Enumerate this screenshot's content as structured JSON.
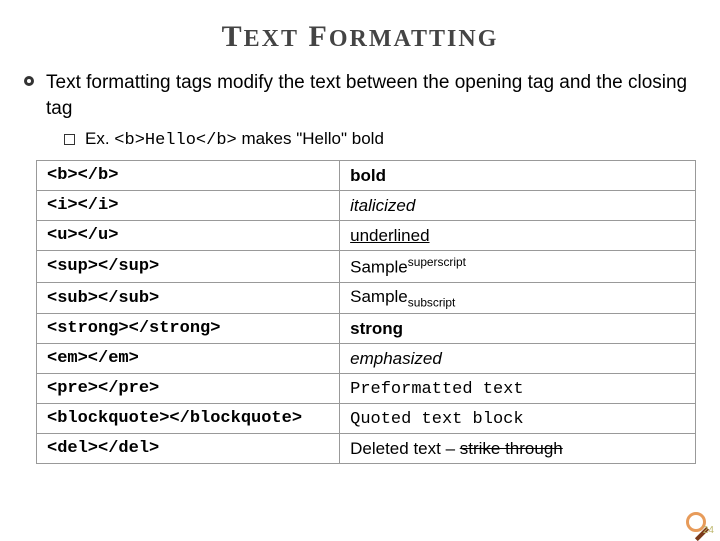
{
  "title_parts": {
    "t1": "T",
    "t2": "EXT",
    "sp": " ",
    "f1": "F",
    "f2": "ORMATTING"
  },
  "desc": "Text formatting tags modify the text between the opening tag and the closing tag",
  "example": {
    "prefix": "Ex. ",
    "code": "<b>Hello</b>",
    "suffix": " makes \"Hello\" bold"
  },
  "rows": [
    {
      "tag": "<b></b>",
      "type": "bold",
      "text": "bold"
    },
    {
      "tag": "<i></i>",
      "type": "ital",
      "text": "italicized"
    },
    {
      "tag": "<u></u>",
      "type": "und",
      "text": "underlined"
    },
    {
      "tag": "<sup></sup>",
      "type": "sup",
      "base": "Sample",
      "script": "superscript"
    },
    {
      "tag": "<sub></sub>",
      "type": "sub",
      "base": "Sample",
      "script": "subscript"
    },
    {
      "tag": "<strong></strong>",
      "type": "bold",
      "text": "strong"
    },
    {
      "tag": "<em></em>",
      "type": "ital",
      "text": "emphasized"
    },
    {
      "tag": "<pre></pre>",
      "type": "mono",
      "text": "Preformatted text"
    },
    {
      "tag": "<blockquote></blockquote>",
      "type": "mono",
      "text": "Quoted text block"
    },
    {
      "tag": "<del></del>",
      "type": "del",
      "pre": "Deleted text – ",
      "strike": "strike through"
    }
  ],
  "pagenum": "24"
}
